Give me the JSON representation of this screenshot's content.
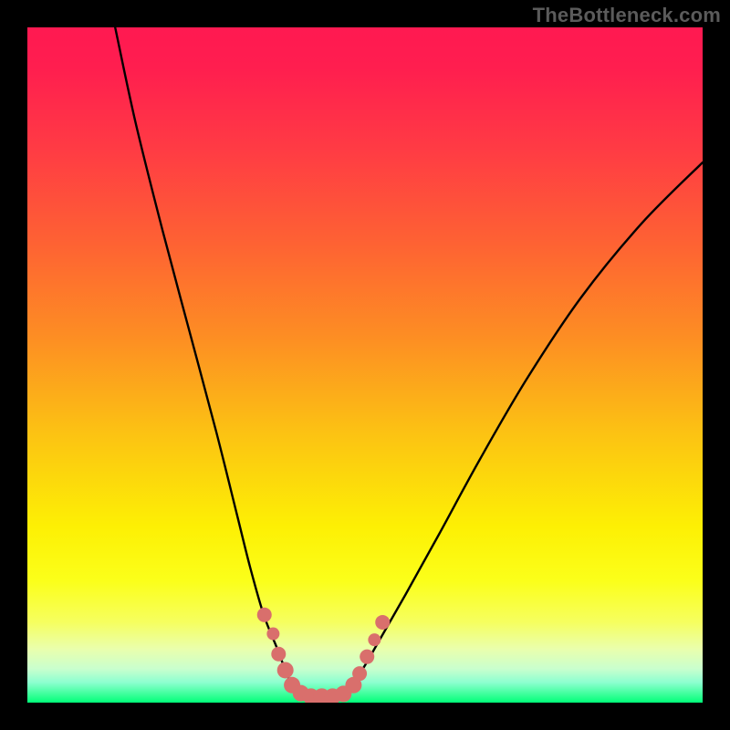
{
  "watermark": "TheBottleneck.com",
  "chart_data": {
    "type": "line",
    "title": "",
    "xlabel": "",
    "ylabel": "",
    "xlim": [
      0,
      100
    ],
    "ylim": [
      0,
      100
    ],
    "series": [
      {
        "name": "bottleneck-curve",
        "x": [
          13,
          16,
          20,
          24,
          28,
          31,
          33,
          35,
          37,
          39,
          41,
          43,
          46,
          49,
          52,
          56,
          61,
          67,
          74,
          82,
          91,
          100
        ],
        "y": [
          100,
          86,
          70,
          55,
          40,
          28,
          20,
          13,
          8,
          3,
          1,
          1,
          1,
          4,
          9,
          16,
          25,
          36,
          48,
          60,
          71,
          80
        ]
      }
    ],
    "markers": {
      "name": "highlight-dots",
      "color": "#d96f6c",
      "points": [
        {
          "x": 35.1,
          "y": 13.0,
          "r": 8
        },
        {
          "x": 36.4,
          "y": 10.2,
          "r": 7
        },
        {
          "x": 37.2,
          "y": 7.2,
          "r": 8
        },
        {
          "x": 38.2,
          "y": 4.8,
          "r": 9
        },
        {
          "x": 39.2,
          "y": 2.6,
          "r": 9
        },
        {
          "x": 40.5,
          "y": 1.4,
          "r": 9
        },
        {
          "x": 42.0,
          "y": 0.9,
          "r": 9
        },
        {
          "x": 43.6,
          "y": 0.9,
          "r": 9
        },
        {
          "x": 45.2,
          "y": 0.9,
          "r": 9
        },
        {
          "x": 46.8,
          "y": 1.3,
          "r": 9
        },
        {
          "x": 48.3,
          "y": 2.6,
          "r": 9
        },
        {
          "x": 49.2,
          "y": 4.3,
          "r": 8
        },
        {
          "x": 50.3,
          "y": 6.8,
          "r": 8
        },
        {
          "x": 51.4,
          "y": 9.3,
          "r": 7
        },
        {
          "x": 52.6,
          "y": 11.9,
          "r": 8
        }
      ]
    },
    "gradient_stops": [
      {
        "pos": 0,
        "color": "#ff1951"
      },
      {
        "pos": 50,
        "color": "#fdaa1a"
      },
      {
        "pos": 78,
        "color": "#fdf004"
      },
      {
        "pos": 100,
        "color": "#00ff79"
      }
    ]
  }
}
